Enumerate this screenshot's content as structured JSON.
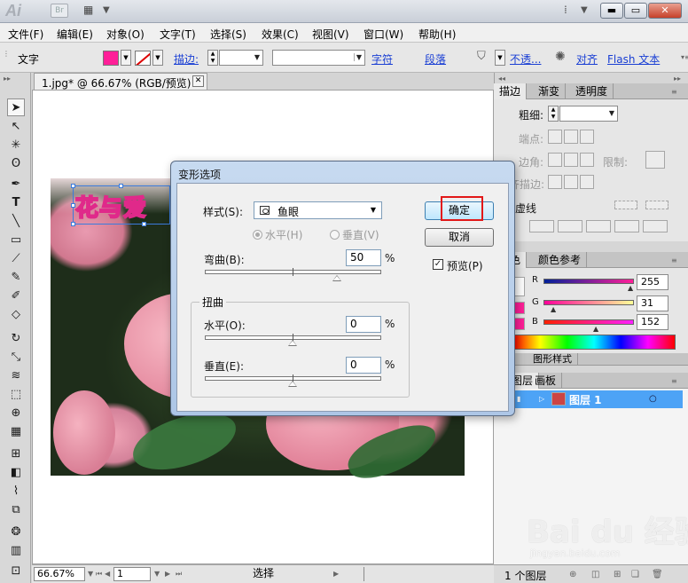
{
  "titlebar": {
    "app_logo": "Ai",
    "bridge_label": "Br",
    "arrange_icon": "arrange-documents-icon"
  },
  "menubar": {
    "items": [
      "文件(F)",
      "编辑(E)",
      "对象(O)",
      "文字(T)",
      "选择(S)",
      "效果(C)",
      "视图(V)",
      "窗口(W)",
      "帮助(H)"
    ]
  },
  "control_bar": {
    "context_label": "文字",
    "fill_color": "#ff1f98",
    "stroke_label": "描边:",
    "opacity_label": "不透...",
    "char_label": "字符",
    "para_label": "段落",
    "align_label": "对齐",
    "flash_label": "Flash 文本"
  },
  "document": {
    "tab_title": "1.jpg* @ 66.67% (RGB/预览)",
    "art_text": "花与爱"
  },
  "statusbar": {
    "zoom": "66.67%",
    "page": "1",
    "tool_status": "选择"
  },
  "panels": {
    "stroke_tabs": [
      "描边",
      "渐变",
      "透明度"
    ],
    "weight_label": "粗细:",
    "cap_label": "端点:",
    "corner_label": "边角:",
    "limit_label": "限制:",
    "align_stroke_label": "对齐描边:",
    "dashed_label": "虚线",
    "color_tabs": [
      "颜色",
      "颜色参考"
    ],
    "r_label": "R",
    "g_label": "G",
    "b_label": "B",
    "r_value": "255",
    "g_value": "31",
    "b_value": "152",
    "graphic_styles_tab": "图形样式",
    "layer_tabs": [
      "图层",
      "画板"
    ],
    "layer_name": "图层 1",
    "layer_count": "1 个图层"
  },
  "dialog": {
    "title": "变形选项",
    "style_label": "样式(S):",
    "style_value": "鱼眼",
    "horizontal_label": "水平(H)",
    "vertical_label": "垂直(V)",
    "bend_label": "弯曲(B):",
    "bend_value": "50",
    "percent": "%",
    "distort_title": "扭曲",
    "dist_h_label": "水平(O):",
    "dist_h_value": "0",
    "dist_v_label": "垂直(E):",
    "dist_v_value": "0",
    "ok_label": "确定",
    "cancel_label": "取消",
    "preview_label": "预览(P)",
    "preview_checked": true
  },
  "watermark": {
    "brand": "Bai du 经验",
    "url": "jingyan.baidu.com"
  }
}
